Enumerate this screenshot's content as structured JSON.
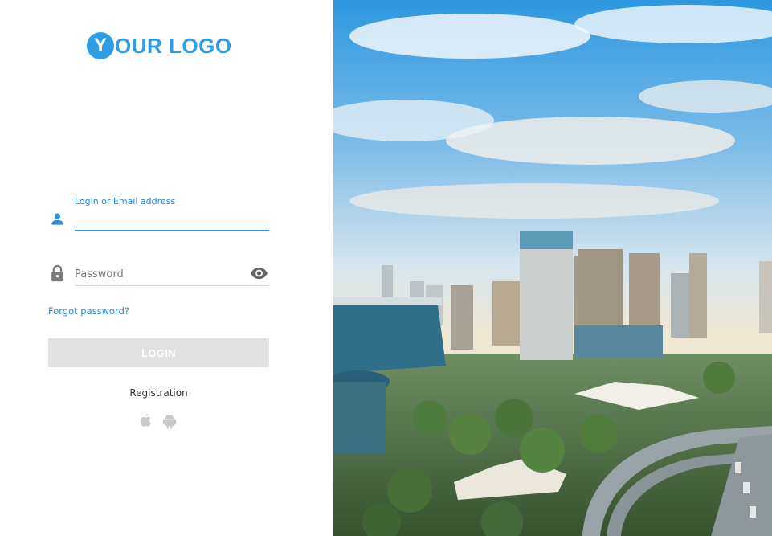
{
  "logo": {
    "letter": "Y",
    "text": "OUR LOGO",
    "color": "#2b9ee6"
  },
  "login_form": {
    "login_label": "Login or Email address",
    "login_value": "",
    "password_placeholder": "Password",
    "forgot_password": "Forgot password?",
    "login_button": "LOGIN",
    "registration": "Registration",
    "platform_icons": [
      "apple-icon",
      "android-icon"
    ]
  },
  "colors": {
    "accent": "#2b9ee6",
    "button_disabled": "#e1e1e1"
  }
}
